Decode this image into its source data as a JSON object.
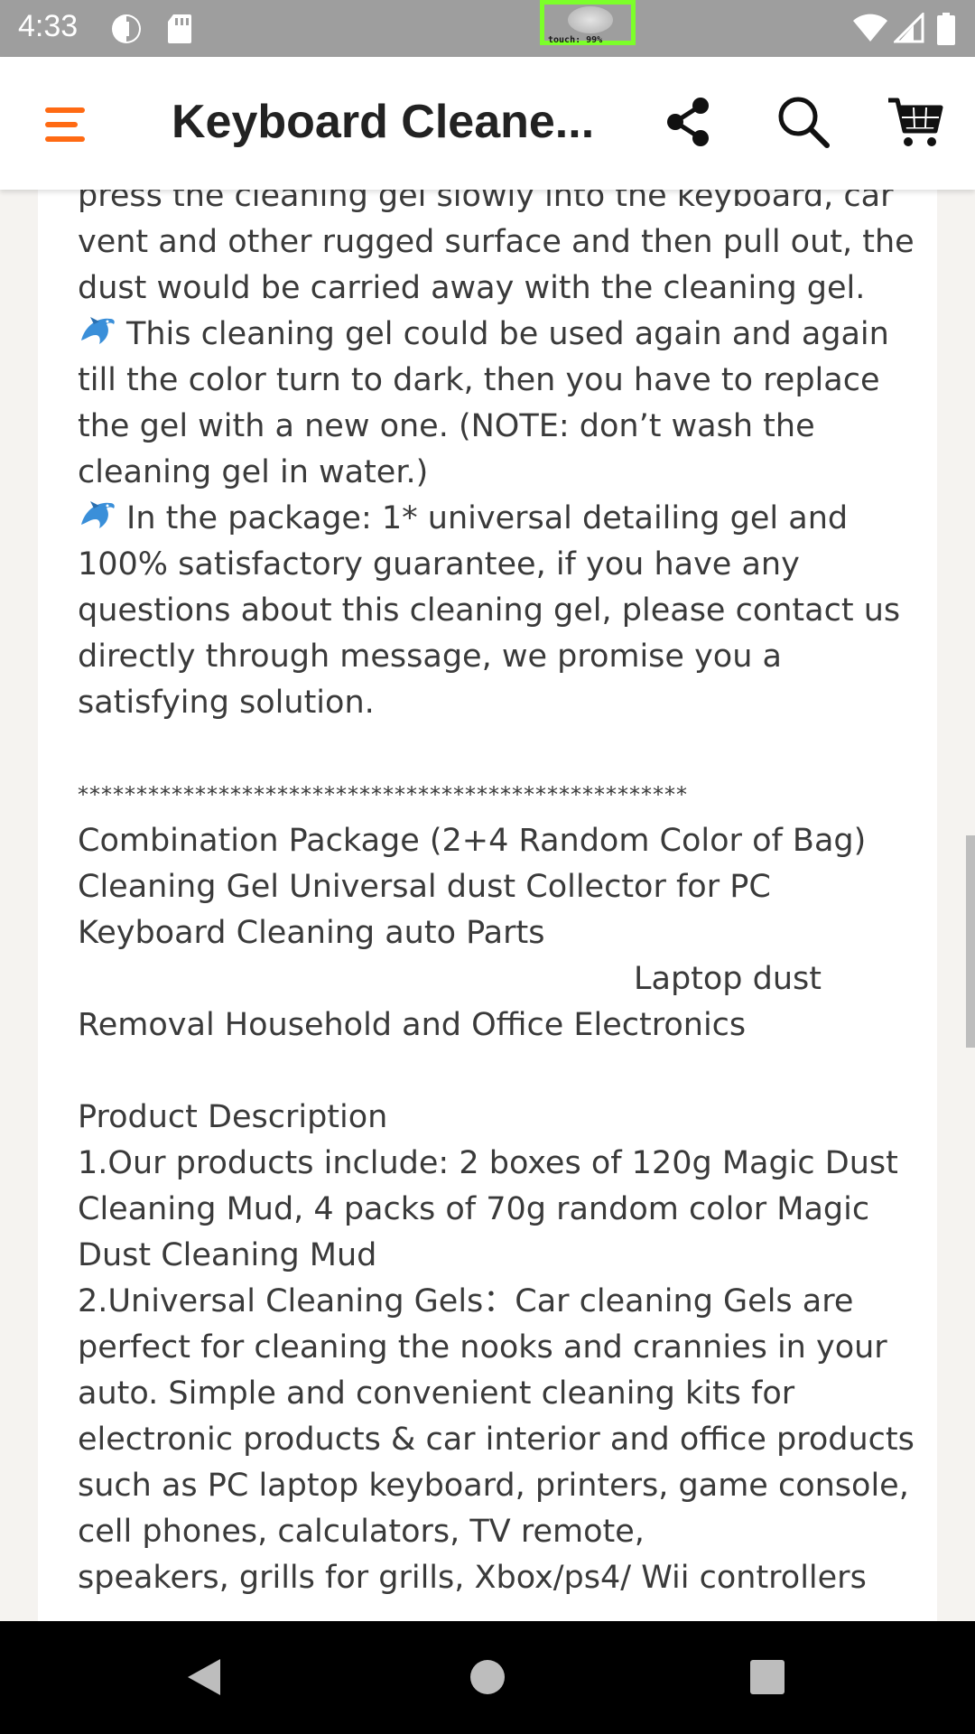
{
  "status_bar": {
    "time": "4:33",
    "touch_label": "touch: 99%",
    "icons": [
      "data-saver-icon",
      "sd-card-icon",
      "wifi-icon",
      "signal-icon",
      "battery-icon"
    ]
  },
  "app_bar": {
    "title": "Keyboard Cleane...",
    "icons": [
      "menu-icon",
      "share-icon",
      "search-icon",
      "cart-icon"
    ],
    "accent_color": "#ff6a13"
  },
  "description": {
    "para1": "press the cleaning gel slowly into the keyboard, car vent and other rugged surface and then pull out, the dust would be carried away with the cleaning gel.",
    "para2": "This cleaning gel could be used again and again till the color turn to dark, then you have to replace the gel with a new one. (NOTE: don’t wash the cleaning gel in water.)",
    "para3": "In the package: 1* universal detailing gel and 100% satisfactory guarantee, if you have any questions about this cleaning gel, please contact us directly through message, we promise you a satisfying solution.",
    "separator": "****************************************************",
    "combo_title": "Combination Package (2+4 Random Color of Bag) Cleaning Gel Universal dust Collector for PC Keyboard Cleaning auto Parts",
    "combo_line2": "Laptop dust",
    "combo_line3": "Removal Household and Office Electronics",
    "pd_heading": "Product Description",
    "pd_item1": "1.Our products include: 2 boxes of 120g Magic Dust Cleaning Mud, 4 packs of 70g random color Magic Dust Cleaning Mud",
    "pd_item2": "2.Universal Cleaning Gels：Car cleaning Gels are perfect for cleaning the nooks and crannies in your auto. Simple and convenient cleaning kits for electronic products & car interior and office products such as PC laptop keyboard, printers, game console, cell phones, calculators, TV remote,",
    "pd_item2_cut": "speakers, grills for grills, Xbox/ps4/ Wii controllers"
  },
  "nav_bar": {
    "icons": [
      "back-icon",
      "home-icon",
      "recents-icon"
    ]
  }
}
